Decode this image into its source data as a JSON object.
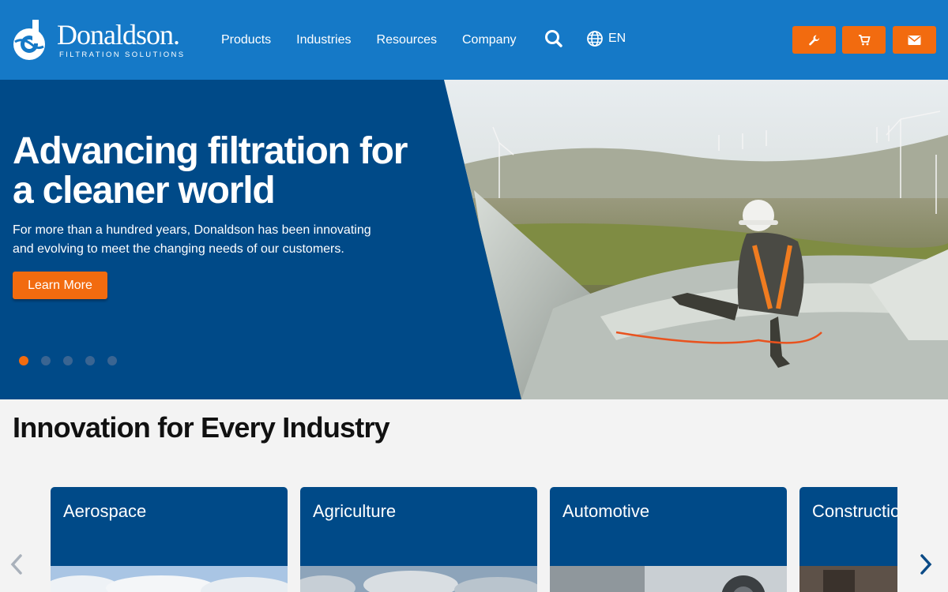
{
  "header": {
    "logo_name": "Donaldson.",
    "logo_tagline": "FILTRATION SOLUTIONS",
    "nav": [
      "Products",
      "Industries",
      "Resources",
      "Company"
    ],
    "language": "EN",
    "icons": {
      "search": "search-icon",
      "language": "globe-icon",
      "tools": "wrench-icon",
      "cart": "cart-icon",
      "contact": "envelope-icon"
    }
  },
  "hero": {
    "title": "Advancing filtration for a cleaner world",
    "text": "For more than a hundred years, Donaldson has been innovating and evolving to meet the changing needs of our customers.",
    "button": "Learn More",
    "slides_total": 5,
    "active_slide": 1
  },
  "industries": {
    "title": "Innovation for Every Industry",
    "cards": [
      "Aerospace",
      "Agriculture",
      "Automotive",
      "Construction"
    ]
  },
  "colors": {
    "header": "#1579c7",
    "navy": "#004a88",
    "accent": "#f26b0f"
  }
}
